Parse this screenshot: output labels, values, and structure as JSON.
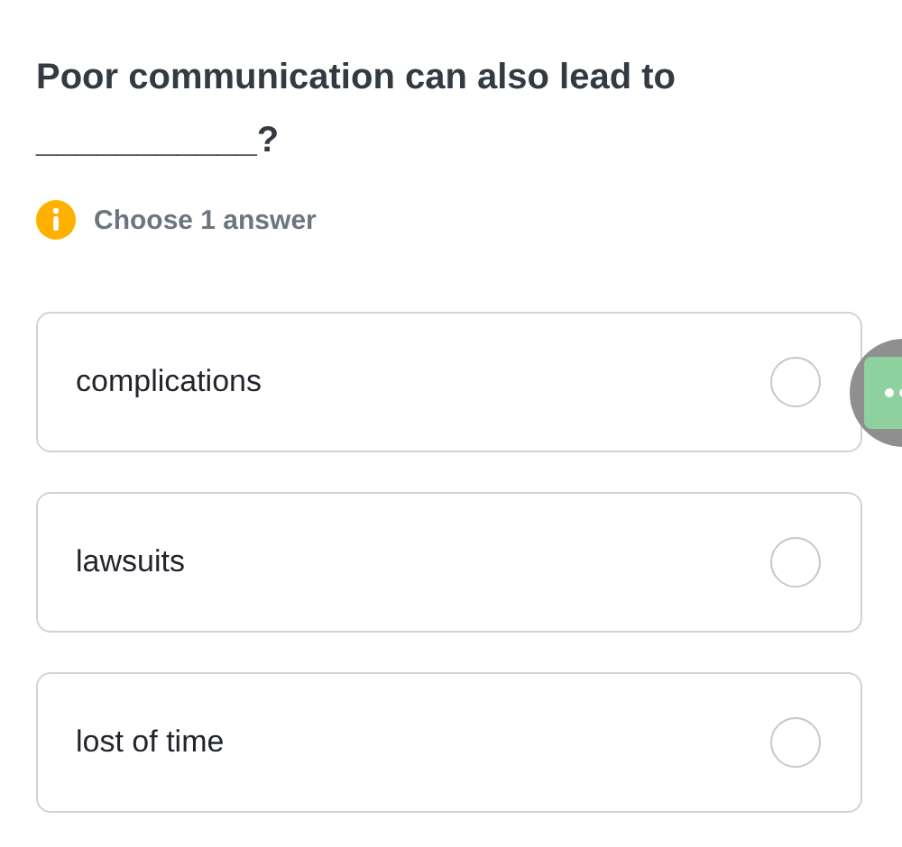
{
  "question": "Poor communication can also lead to ___________?",
  "hint": "Choose 1 answer",
  "options": [
    {
      "label": "complications",
      "selected": false
    },
    {
      "label": "lawsuits",
      "selected": false
    },
    {
      "label": "lost of time",
      "selected": false
    }
  ]
}
